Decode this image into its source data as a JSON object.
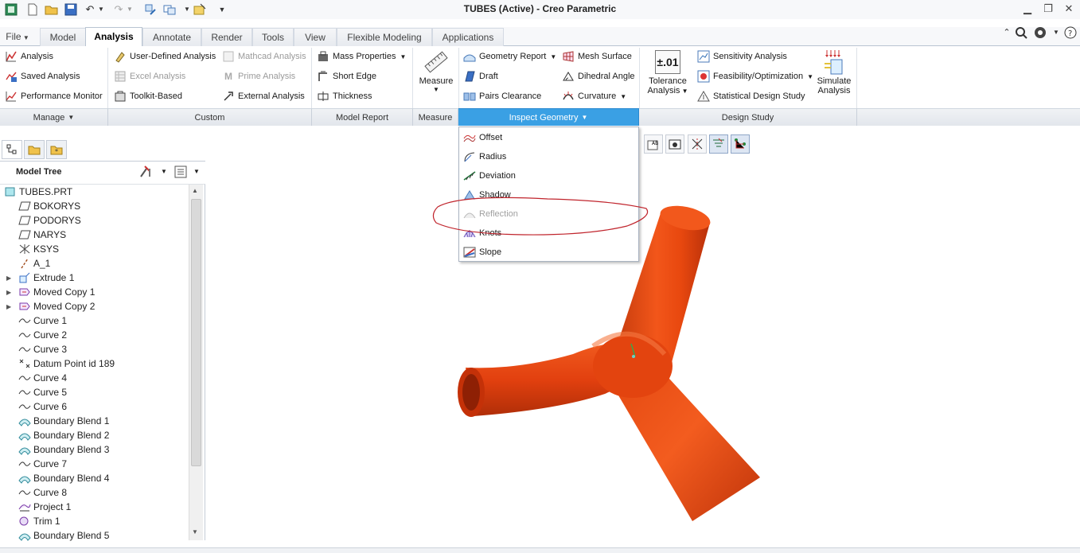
{
  "window": {
    "title": "TUBES (Active) - Creo Parametric",
    "controls": [
      "minimize-icon",
      "restore-icon",
      "close-icon"
    ]
  },
  "quick_access": [
    "app-icon",
    "new-icon",
    "open-icon",
    "save-icon",
    "undo-icon",
    "redo-icon",
    "regenerate-icon",
    "windows-icon",
    "close-window-icon",
    "customize-icon"
  ],
  "help_icons": [
    "collapse-ribbon-icon",
    "search-icon",
    "help-icon"
  ],
  "tabs": [
    {
      "label": "File",
      "active": false
    },
    {
      "label": "Model",
      "active": false
    },
    {
      "label": "Analysis",
      "active": true
    },
    {
      "label": "Annotate",
      "active": false
    },
    {
      "label": "Render",
      "active": false
    },
    {
      "label": "Tools",
      "active": false
    },
    {
      "label": "View",
      "active": false
    },
    {
      "label": "Flexible Modeling",
      "active": false
    },
    {
      "label": "Applications",
      "active": false
    }
  ],
  "ribbon": {
    "manage": {
      "analysis": "Analysis",
      "saved_analysis": "Saved Analysis",
      "performance_monitor": "Performance Monitor",
      "group": "Manage"
    },
    "custom": {
      "user_defined": "User-Defined Analysis",
      "excel": "Excel Analysis",
      "toolkit": "Toolkit-Based",
      "mathcad": "Mathcad Analysis",
      "prime": "Prime Analysis",
      "external": "External Analysis",
      "group": "Custom"
    },
    "model_report": {
      "mass_properties": "Mass Properties",
      "short_edge": "Short Edge",
      "thickness": "Thickness",
      "group": "Model Report"
    },
    "measure": {
      "measure": "Measure",
      "group": "Measure"
    },
    "inspect": {
      "geometry_report": "Geometry Report",
      "draft": "Draft",
      "pairs_clearance": "Pairs Clearance",
      "mesh_surface": "Mesh Surface",
      "dihedral_angle": "Dihedral Angle",
      "curvature": "Curvature",
      "group": "Inspect Geometry"
    },
    "design_study": {
      "tolerance_icon_text": "±.01",
      "tolerance_line1": "Tolerance",
      "tolerance_line2": "Analysis",
      "sensitivity": "Sensitivity Analysis",
      "feasibility": "Feasibility/Optimization",
      "statistical": "Statistical Design Study",
      "simulate_line1": "Simulate",
      "simulate_line2": "Analysis",
      "group": "Design Study"
    }
  },
  "inspect_menu": {
    "items": [
      {
        "label": "Offset",
        "enabled": true
      },
      {
        "label": "Radius",
        "enabled": true
      },
      {
        "label": "Deviation",
        "enabled": true
      },
      {
        "label": "Shadow",
        "enabled": true
      },
      {
        "label": "Reflection",
        "enabled": false
      },
      {
        "label": "Knots",
        "enabled": true
      },
      {
        "label": "Slope",
        "enabled": true
      }
    ]
  },
  "model_tree": {
    "title": "Model Tree",
    "nodes": [
      {
        "label": "TUBES.PRT",
        "icon": "part-icon",
        "expandable": false
      },
      {
        "label": "BOKORYS",
        "icon": "datum-plane-icon",
        "expandable": false
      },
      {
        "label": "PODORYS",
        "icon": "datum-plane-icon",
        "expandable": false
      },
      {
        "label": "NARYS",
        "icon": "datum-plane-icon",
        "expandable": false
      },
      {
        "label": "KSYS",
        "icon": "coordinate-system-icon",
        "expandable": false
      },
      {
        "label": "A_1",
        "icon": "datum-axis-icon",
        "expandable": false
      },
      {
        "label": "Extrude 1",
        "icon": "extrude-icon",
        "expandable": true
      },
      {
        "label": "Moved Copy 1",
        "icon": "moved-copy-icon",
        "expandable": true
      },
      {
        "label": "Moved Copy 2",
        "icon": "moved-copy-icon",
        "expandable": true
      },
      {
        "label": "Curve 1",
        "icon": "curve-icon",
        "expandable": false
      },
      {
        "label": "Curve 2",
        "icon": "curve-icon",
        "expandable": false
      },
      {
        "label": "Curve 3",
        "icon": "curve-icon",
        "expandable": false
      },
      {
        "label": "Datum Point id 189",
        "icon": "datum-point-icon",
        "expandable": false
      },
      {
        "label": "Curve 4",
        "icon": "curve-icon",
        "expandable": false
      },
      {
        "label": "Curve 5",
        "icon": "curve-icon",
        "expandable": false
      },
      {
        "label": "Curve 6",
        "icon": "curve-icon",
        "expandable": false
      },
      {
        "label": "Boundary Blend 1",
        "icon": "boundary-blend-icon",
        "expandable": false
      },
      {
        "label": "Boundary Blend 2",
        "icon": "boundary-blend-icon",
        "expandable": false
      },
      {
        "label": "Boundary Blend 3",
        "icon": "boundary-blend-icon",
        "expandable": false
      },
      {
        "label": "Curve 7",
        "icon": "curve-icon",
        "expandable": false
      },
      {
        "label": "Boundary Blend 4",
        "icon": "boundary-blend-icon",
        "expandable": false
      },
      {
        "label": "Curve 8",
        "icon": "curve-icon",
        "expandable": false
      },
      {
        "label": "Project 1",
        "icon": "project-icon",
        "expandable": false
      },
      {
        "label": "Trim 1",
        "icon": "trim-icon",
        "expandable": false
      },
      {
        "label": "Boundary Blend 5",
        "icon": "boundary-blend-icon",
        "expandable": false
      }
    ]
  },
  "colors": {
    "model": "#e2400f",
    "accent": "#3aa0e4",
    "annotation": "#c0242c"
  }
}
